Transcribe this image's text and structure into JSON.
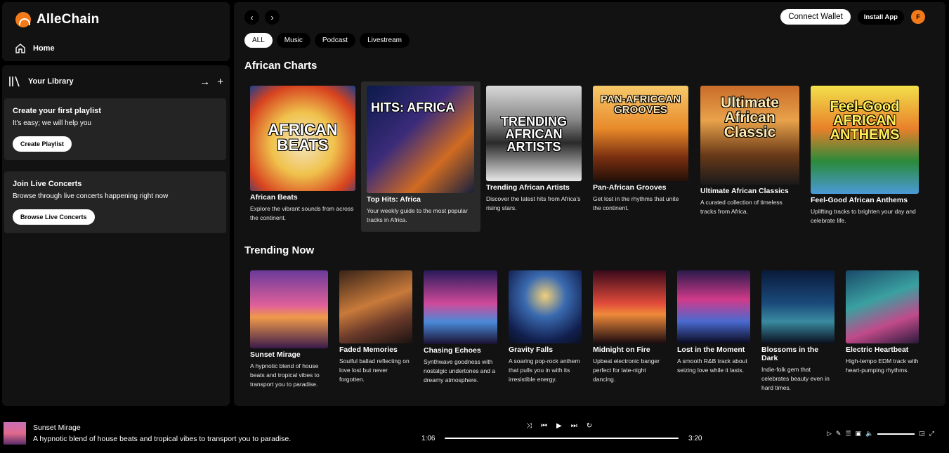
{
  "brand": {
    "name": "AlleChain"
  },
  "nav": {
    "home": "Home"
  },
  "library": {
    "title": "Your Library",
    "playlist_card": {
      "title": "Create your first playlist",
      "text": "It's easy; we will help you",
      "button": "Create Playlist"
    },
    "concerts_card": {
      "title": "Join Live Concerts",
      "text": "Browse through live concerts happening right now",
      "button": "Browse Live Concerts"
    }
  },
  "header": {
    "connect_wallet": "Connect Wallet",
    "install_app": "Install App",
    "avatar_letter": "F"
  },
  "filters": [
    "ALL",
    "Music",
    "Podcast",
    "Livestream"
  ],
  "sections": {
    "charts": {
      "title": "African Charts",
      "items": [
        {
          "title": "African Beats",
          "desc": "Explore the vibrant sounds from across the continent.",
          "art_text": "AFRICAN BEATS"
        },
        {
          "title": "Top Hits: Africa",
          "desc": "Your weekly guide to the most popular tracks in Africa.",
          "art_text": "HITS: AFRICA"
        },
        {
          "title": "Trending African Artists",
          "desc": "Discover the latest hits from Africa's rising stars.",
          "art_text": "TRENDING AFRICAN ARTISTS"
        },
        {
          "title": "Pan-African Grooves",
          "desc": "Get lost in the rhythms that unite the continent.",
          "art_text": "PAN-AFRICCAN GROOVES"
        },
        {
          "title": "Ultimate African Classics",
          "desc": "A curated collection of timeless tracks from Africa.",
          "art_text": "Ultimate African Classic"
        },
        {
          "title": "Feel-Good African Anthems",
          "desc": "Uplifting tracks to brighten your day and celebrate life.",
          "art_text": "Feel-Good AFRICAN ANTHEMS"
        }
      ]
    },
    "trending": {
      "title": "Trending Now",
      "items": [
        {
          "title": "Sunset Mirage",
          "desc": "A hypnotic blend of house beats and tropical vibes to transport you to paradise."
        },
        {
          "title": "Faded Memories",
          "desc": "Soulful ballad reflecting on love lost but never forgotten."
        },
        {
          "title": "Chasing Echoes",
          "desc": "Synthwave goodness with nostalgic undertones and a dreamy atmosphere."
        },
        {
          "title": "Gravity Falls",
          "desc": "A soaring pop-rock anthem that pulls you in with its irresistible energy."
        },
        {
          "title": "Midnight on Fire",
          "desc": "Upbeat electronic banger perfect for late-night dancing."
        },
        {
          "title": "Lost in the Moment",
          "desc": "A smooth R&B track about seizing love while it lasts."
        },
        {
          "title": "Blossoms in the Dark",
          "desc": "Indie-folk gem that celebrates beauty even in hard times."
        },
        {
          "title": "Electric Heartbeat",
          "desc": "High-tempo EDM track with heart-pumping rhythms."
        }
      ]
    }
  },
  "player": {
    "title": "Sunset Mirage",
    "desc": "A hypnotic blend of house beats and tropical vibes to transport you to paradise.",
    "time_current": "1:06",
    "time_total": "3:20",
    "progress": 0.33
  },
  "colors": {
    "accent": "#f27a1a",
    "panel": "#121212",
    "card": "#242424"
  }
}
